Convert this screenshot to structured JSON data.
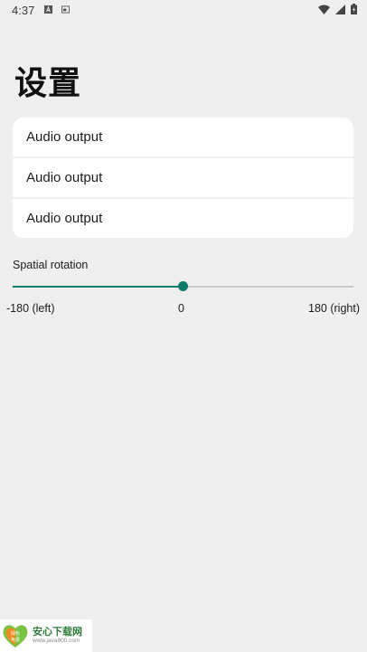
{
  "status_bar": {
    "time": "4:37",
    "icons": [
      "a-icon",
      "card-icon",
      "wifi-icon",
      "signal-icon",
      "battery-icon"
    ]
  },
  "page": {
    "title": "设置"
  },
  "audio_outputs": [
    {
      "label": "Audio output"
    },
    {
      "label": "Audio output"
    },
    {
      "label": "Audio output"
    }
  ],
  "spatial_rotation": {
    "label": "Spatial rotation",
    "min_label": "-180 (left)",
    "mid_label": "0",
    "max_label": "180 (right)",
    "min": -180,
    "max": 180,
    "value": 0
  },
  "watermark": {
    "title": "安心下载网",
    "url": "www.java800.com",
    "logo_text_top": "绿色",
    "logo_text_bottom": "免费"
  },
  "colors": {
    "background": "#efefef",
    "card": "#ffffff",
    "accent": "#0e7c6a",
    "track": "#c9c9c9"
  }
}
